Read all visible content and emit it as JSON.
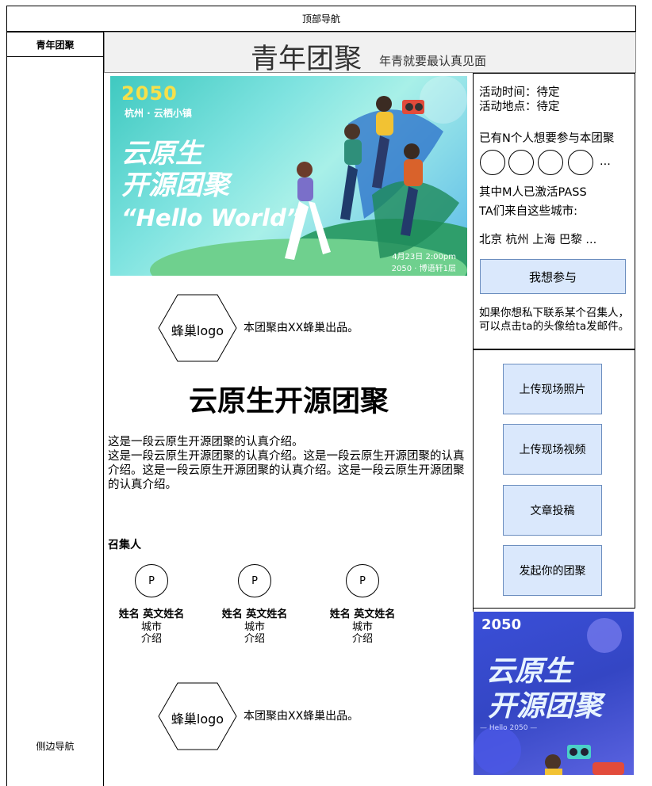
{
  "top_nav": {
    "label": "顶部导航"
  },
  "sidebar": {
    "tab": "青年团聚",
    "label": "侧边导航"
  },
  "header": {
    "title": "青年团聚",
    "subtitle": "年青就要最认真见面"
  },
  "banner": {
    "logo": "2050",
    "location": "杭州 · 云栖小镇",
    "title_line1": "云原生",
    "title_line2": "开源团聚",
    "tagline": "“Hello World”",
    "date": "4月23日 2:00pm",
    "venue": "2050 · 博语轩1层"
  },
  "producer": {
    "logo_label": "蜂巢logo",
    "text": "本团聚由XX蜂巢出品。"
  },
  "event": {
    "title": "云原生开源团聚",
    "intro_line1": "这是一段云原生开源团聚的认真介绍。",
    "intro_line2": "这是一段云原生开源团聚的认真介绍。这是一段云原生开源团聚的认真介绍。这是一段云原生开源团聚的认真介绍。这是一段云原生开源团聚的认真介绍。"
  },
  "organizers": {
    "title": "召集人",
    "items": [
      {
        "avatar": "P",
        "name": "姓名 英文姓名",
        "city": "城市",
        "intro": "介绍"
      },
      {
        "avatar": "P",
        "name": "姓名 英文姓名",
        "city": "城市",
        "intro": "介绍"
      },
      {
        "avatar": "P",
        "name": "姓名 英文姓名",
        "city": "城市",
        "intro": "介绍"
      }
    ]
  },
  "info": {
    "time": "活动时间：待定",
    "place": "活动地点：待定",
    "interested": "已有N个人想要参与本团聚",
    "more": "...",
    "activated": "其中M人已激活PASS",
    "cities_title": "TA们来自这些城市:",
    "cities": "北京 杭州 上海 巴黎 ...",
    "join_button": "我想参与",
    "contact_note": "如果你想私下联系某个召集人，可以点击ta的头像给ta发邮件。"
  },
  "actions": {
    "upload_photo": "上传现场照片",
    "upload_video": "上传现场视频",
    "submit_article": "文章投稿",
    "start_gathering": "发起你的团聚"
  },
  "poster": {
    "logo": "2050",
    "title_line1": "云原生",
    "title_line2": "开源团聚",
    "footer": "— Hello 2050 —"
  },
  "colors": {
    "button_fill": "#dae8fc",
    "button_border": "#6c8ebf",
    "header_bg": "#f1f1f1"
  }
}
